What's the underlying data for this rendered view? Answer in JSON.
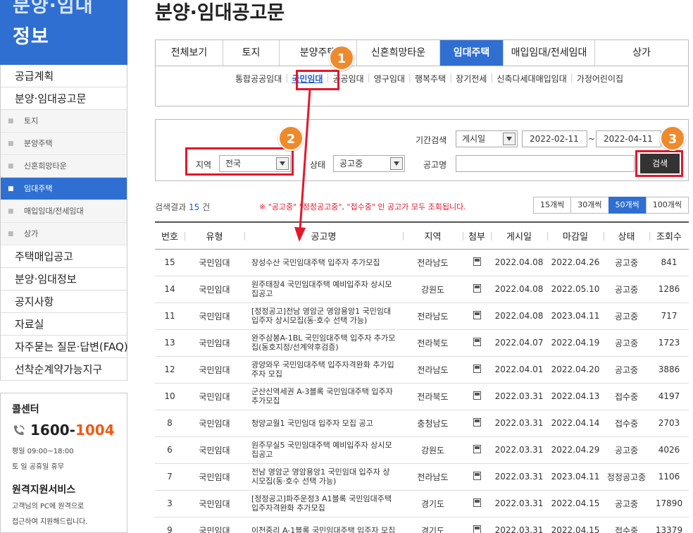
{
  "sidebar": {
    "header_line1": "분양·임대",
    "header_line2": "정보",
    "items": [
      {
        "label": "공급계획",
        "level": 1
      },
      {
        "label": "분양·임대공고문",
        "level": 1
      },
      {
        "label": "토지",
        "level": 2
      },
      {
        "label": "분양주택",
        "level": 2
      },
      {
        "label": "신혼희망타운",
        "level": 2
      },
      {
        "label": "임대주택",
        "level": 2,
        "active": true
      },
      {
        "label": "매입임대/전세임대",
        "level": 2
      },
      {
        "label": "상가",
        "level": 2
      },
      {
        "label": "주택매입공고",
        "level": 1
      },
      {
        "label": "분양·임대정보",
        "level": 1
      },
      {
        "label": "공지사항",
        "level": 1
      },
      {
        "label": "자료실",
        "level": 1
      },
      {
        "label": "자주묻는 질문·답변(FAQ)",
        "level": 1
      },
      {
        "label": "선착순계약가능지구",
        "level": 1
      }
    ],
    "callcenter": {
      "title": "콜센터",
      "phone_prefix": "1600-",
      "phone_suffix": "1004",
      "hours1": "평일 09:00~18:00",
      "hours2": "토 일 공휴일 휴무",
      "remote_title": "원격지원서비스",
      "remote_desc1": "고객님의 PC에 원격으로",
      "remote_desc2": "접근하여 지원해드립니다."
    }
  },
  "page": {
    "title": "분양·임대공고문"
  },
  "tabs": [
    {
      "label": "전체보기"
    },
    {
      "label": "토지"
    },
    {
      "label": "분양주택"
    },
    {
      "label": "신혼희망타운"
    },
    {
      "label": "임대주택",
      "active": true
    },
    {
      "label": "매입임대/전세임대"
    },
    {
      "label": "상가"
    }
  ],
  "subtabs": [
    "통합공공임대",
    "국민임대",
    "공공임대",
    "영구임대",
    "행복주택",
    "장기전세",
    "신축다세대매입임대",
    "가정어린이집"
  ],
  "subtab_active": "국민임대",
  "search": {
    "period_label": "기간검색",
    "period_type": "게시일",
    "date_from": "2022-02-11",
    "date_sep": "~",
    "date_to": "2022-04-11",
    "region_label": "지역",
    "region_value": "전국",
    "status_label": "상태",
    "status_value": "공고중",
    "name_label": "공고명",
    "name_value": "",
    "button_label": "검색"
  },
  "badges": [
    "1",
    "2",
    "3"
  ],
  "result": {
    "prefix": "검색결과",
    "count": "15",
    "suffix": "건",
    "notice": "※ \"공고중\" \"정정공고중\", \"접수중\" 인 공고가 모두 조회됩니다."
  },
  "per_page": [
    {
      "label": "15개씩"
    },
    {
      "label": "30개씩"
    },
    {
      "label": "50개씩",
      "active": true
    },
    {
      "label": "100개씩"
    }
  ],
  "table": {
    "headers": [
      "번호",
      "유형",
      "공고명",
      "지역",
      "첨부",
      "게시일",
      "마감일",
      "상태",
      "조회수"
    ],
    "rows": [
      [
        "15",
        "국민임대",
        "장성수산 국민임대주택 입주자 추가모집",
        "전라남도",
        "",
        "2022.04.08",
        "2022.04.26",
        "공고중",
        "841"
      ],
      [
        "14",
        "국민임대",
        "원주태장4 국민임대주택 예비입주자 상시모집공고",
        "강원도",
        "",
        "2022.04.08",
        "2022.05.10",
        "공고중",
        "1286"
      ],
      [
        "11",
        "국민임대",
        "[정정공고]전남 영암군 영암용앙1 국민임대 입주자 상시모집(동·호수 선택 가능)",
        "전라남도",
        "",
        "2022.04.08",
        "2023.04.11",
        "공고중",
        "717"
      ],
      [
        "13",
        "국민임대",
        "완주삼봉A-1BL 국민임대주택 입주자 추가모집(동호지정/선계약후검증)",
        "전라북도",
        "",
        "2022.04.07",
        "2022.04.19",
        "공고중",
        "1723"
      ],
      [
        "12",
        "국민임대",
        "광양와우 국민임대주택 입주자격완화 추가입주자 모집",
        "전라남도",
        "",
        "2022.04.01",
        "2022.04.20",
        "공고중",
        "3886"
      ],
      [
        "10",
        "국민임대",
        "군산신역세권 A-3블록 국민임대주택 입주자 추가모집",
        "전라북도",
        "",
        "2022.03.31",
        "2022.04.13",
        "접수중",
        "4197"
      ],
      [
        "8",
        "국민임대",
        "청양교월1 국민임대 입주자 모집 공고",
        "충청남도",
        "",
        "2022.03.31",
        "2022.04.14",
        "접수중",
        "2703"
      ],
      [
        "6",
        "국민임대",
        "원주무실5 국민임대주택 예비입주자 상시모집공고",
        "강원도",
        "",
        "2022.03.31",
        "2022.04.29",
        "공고중",
        "4026"
      ],
      [
        "7",
        "국민임대",
        "전남 영암군 영암용앙1 국민임대 입주자 상시모집(동·호수 선택 가능)",
        "전라남도",
        "",
        "2022.03.31",
        "2023.04.11",
        "정정공고중",
        "1106"
      ],
      [
        "3",
        "국민임대",
        "[정정공고]파주운정3 A1블록 국민임대주택 입주자격완화 추가모집",
        "경기도",
        "",
        "2022.03.31",
        "2022.04.15",
        "공고중",
        "17890"
      ],
      [
        "9",
        "국민임대",
        "이천중리 A-1블록 국민임대주택 입주자 모집",
        "경기도",
        "",
        "2022.03.31",
        "2022.04.15",
        "접수중",
        "13379"
      ]
    ]
  }
}
